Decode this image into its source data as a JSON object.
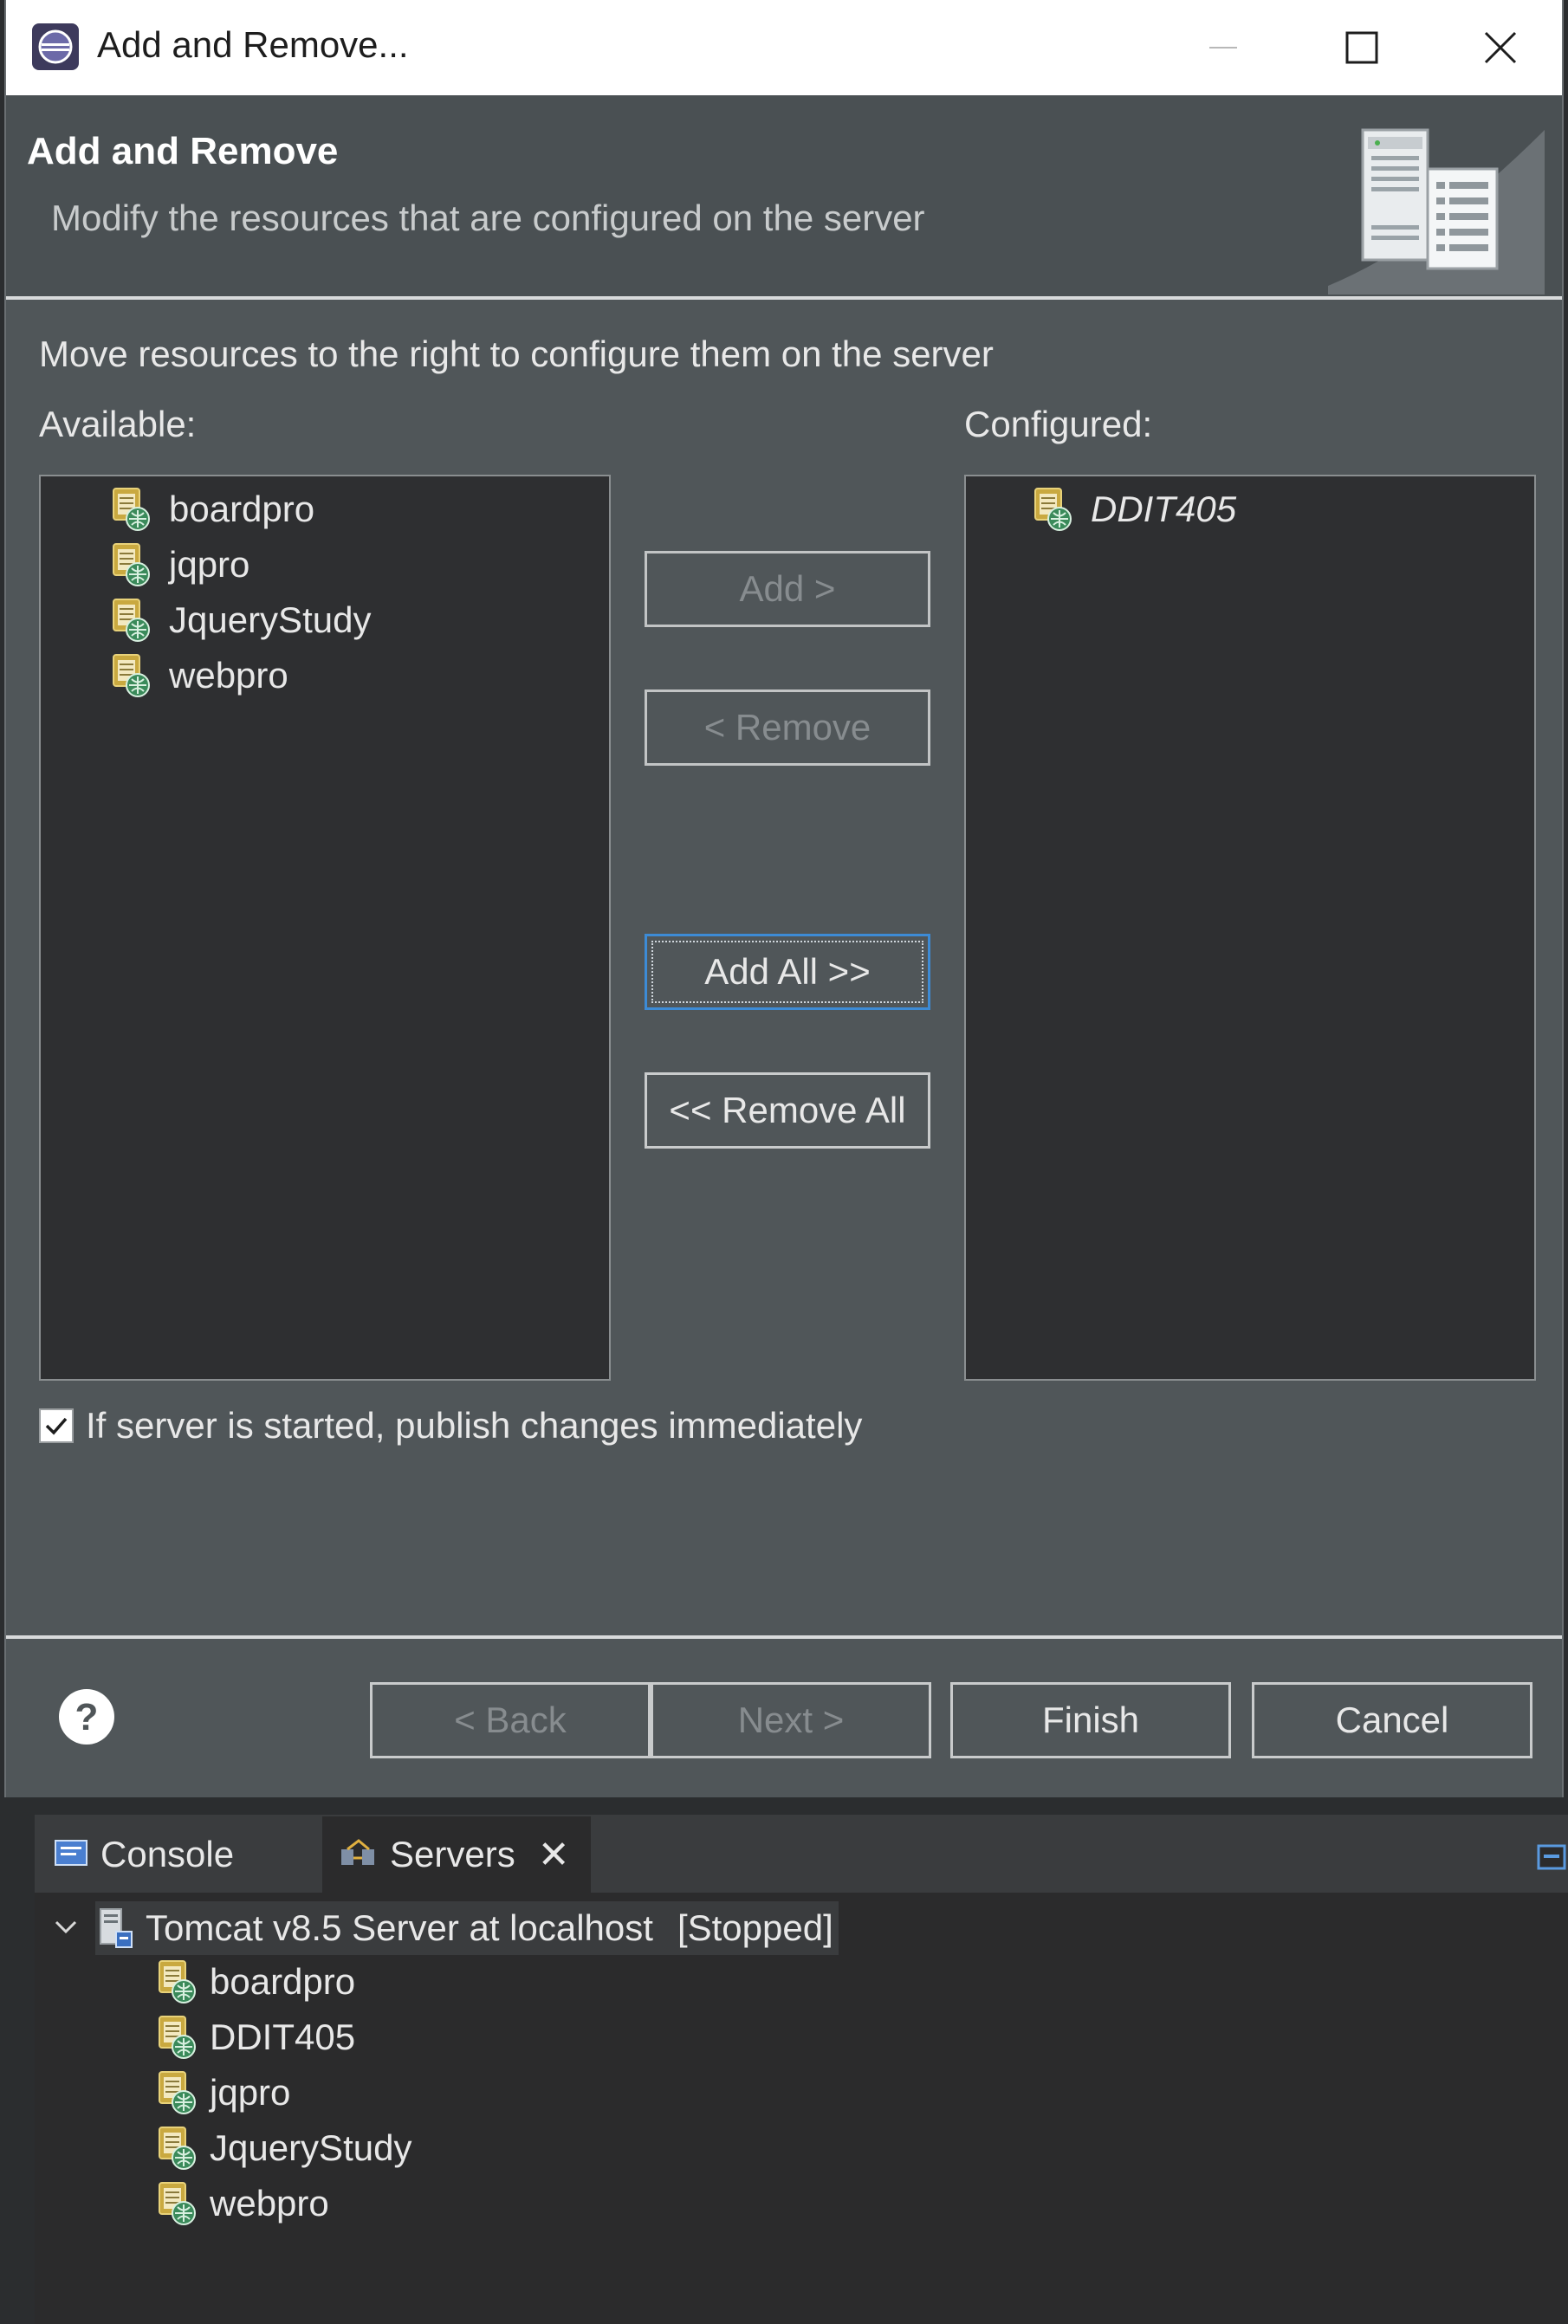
{
  "window": {
    "title": "Add and Remove...",
    "minimize_glyph": "—",
    "maximize_glyph": "☐",
    "close_glyph": "✕"
  },
  "banner": {
    "title": "Add and Remove",
    "description": "Modify the resources that are configured on the server",
    "icon": "server-banner-icon"
  },
  "instructions": "Move resources to the right to configure them on the server",
  "available": {
    "label": "Available:",
    "items": [
      "boardpro",
      "jqpro",
      "JqueryStudy",
      "webpro"
    ]
  },
  "configured": {
    "label": "Configured:",
    "items": [
      "DDIT405"
    ]
  },
  "buttons": {
    "add": "Add >",
    "remove": "< Remove",
    "add_all": "Add All >>",
    "remove_all": "<< Remove All"
  },
  "publish_checkbox": {
    "label": "If server is started, publish changes immediately",
    "checked": true
  },
  "footer": {
    "back": "< Back",
    "next": "Next >",
    "finish": "Finish",
    "cancel": "Cancel"
  },
  "servers_view": {
    "tabs": [
      {
        "label": "Console",
        "icon": "console-icon"
      },
      {
        "label": "Servers",
        "icon": "servers-icon",
        "close": "✕"
      }
    ],
    "server": {
      "name": "Tomcat v8.5 Server at localhost",
      "state": "[Stopped]"
    },
    "modules": [
      "boardpro",
      "DDIT405",
      "jqpro",
      "JqueryStudy",
      "webpro"
    ]
  },
  "colors": {
    "dialog_bg": "#505659",
    "list_bg": "#2e2f31",
    "focus_border": "#3d8bd6",
    "disabled_text": "#878c8f"
  }
}
